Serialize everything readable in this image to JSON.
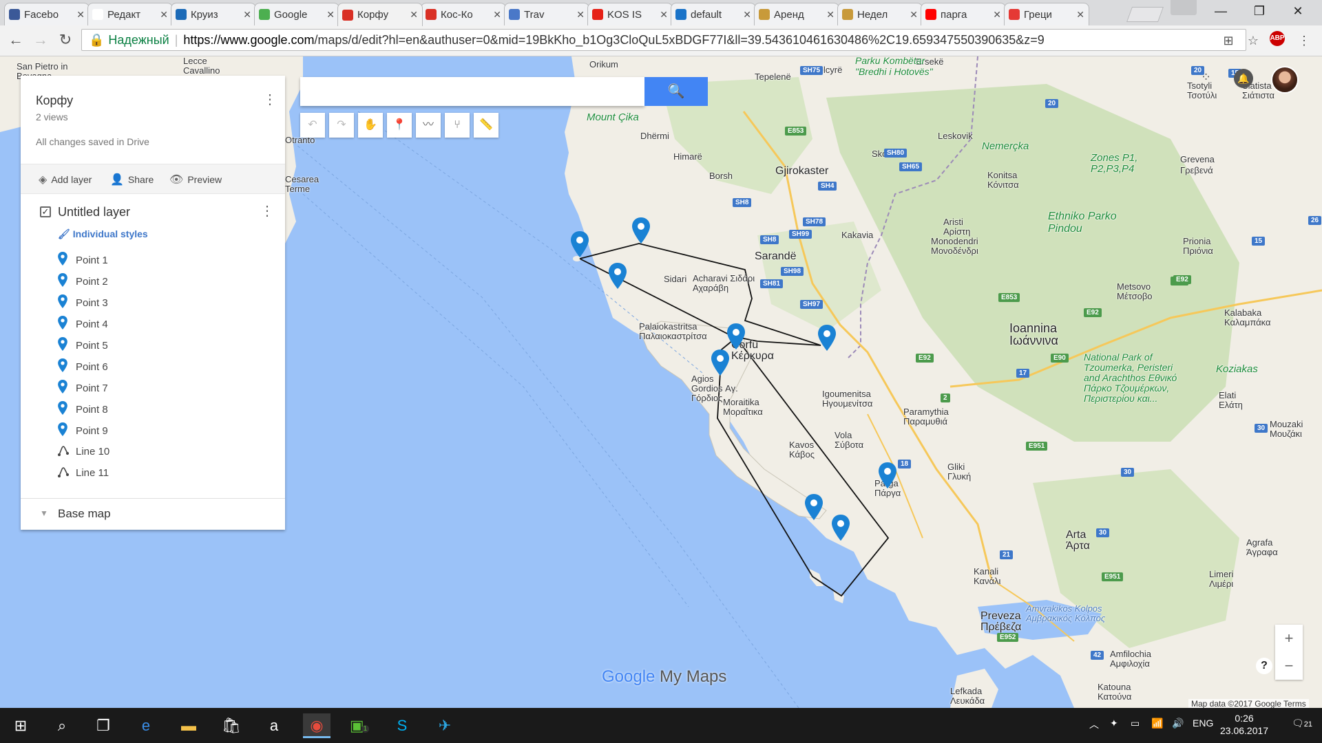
{
  "browser": {
    "tabs": [
      {
        "title": "Facebo",
        "color": "#3b5998"
      },
      {
        "title": "Редакт",
        "color": "#ffffff"
      },
      {
        "title": "Круиз",
        "color": "#1c6bb8"
      },
      {
        "title": "Google",
        "color": "#4caf50"
      },
      {
        "title": "Корфу",
        "color": "#d93025",
        "active": true
      },
      {
        "title": "Кос-Ко",
        "color": "#d93025"
      },
      {
        "title": "Trav",
        "color": "#4a78c8"
      },
      {
        "title": "KOS IS",
        "color": "#e62117"
      },
      {
        "title": "default",
        "color": "#1a73c8"
      },
      {
        "title": "Аренд",
        "color": "#c89a3a"
      },
      {
        "title": "Недел",
        "color": "#c89a3a"
      },
      {
        "title": "парга",
        "color": "#ff0000"
      },
      {
        "title": "Греци",
        "color": "#e53935"
      }
    ],
    "secure_label": "Надежный",
    "url_host": "https://www.google.com",
    "url_path": "/maps/d/edit?hl=en&authuser=0&mid=19BkKho_b1Og3CloQuL5xBDGF77I&ll=39.543610461630486%2C19.659347550390635&z=9",
    "abp_count": "1"
  },
  "panel": {
    "title": "Корфу",
    "views": "2 views",
    "saved": "All changes saved in Drive",
    "add_layer": "Add layer",
    "share": "Share",
    "preview": "Preview",
    "layer_name": "Untitled layer",
    "styles": "Individual styles",
    "items": [
      {
        "label": "Point 1",
        "kind": "point"
      },
      {
        "label": "Point 2",
        "kind": "point"
      },
      {
        "label": "Point 3",
        "kind": "point"
      },
      {
        "label": "Point 4",
        "kind": "point"
      },
      {
        "label": "Point 5",
        "kind": "point"
      },
      {
        "label": "Point 6",
        "kind": "point"
      },
      {
        "label": "Point 7",
        "kind": "point"
      },
      {
        "label": "Point 8",
        "kind": "point"
      },
      {
        "label": "Point 9",
        "kind": "point"
      },
      {
        "label": "Line 10",
        "kind": "line"
      },
      {
        "label": "Line 11",
        "kind": "line"
      }
    ],
    "base_map": "Base map"
  },
  "map": {
    "branding": {
      "google": "Google",
      "mymaps": " My Maps"
    },
    "attribution": "Map data ©2017 Google   Terms",
    "labels": [
      {
        "t": "Orikum"
      },
      {
        "t": "Tepelenë"
      },
      {
        "t": "Këlcyrë"
      },
      {
        "t": "Ersekë"
      },
      {
        "t": "Parku Kombëtar \"Bredhi i Hotovës\""
      },
      {
        "t": "Mount Çika"
      },
      {
        "t": "Dhërmi"
      },
      {
        "t": "Himarë"
      },
      {
        "t": "Borsh"
      },
      {
        "t": "Gjirokaster"
      },
      {
        "t": "Leskovik"
      },
      {
        "t": "Skore"
      },
      {
        "t": "Nemerçka"
      },
      {
        "t": "Zones P1, P2,P3,P4"
      },
      {
        "t": "Konitsa Κόνιτσα"
      },
      {
        "t": "Grevena Γρεβενά"
      },
      {
        "t": "Sarandë"
      },
      {
        "t": "Kakavia"
      },
      {
        "t": "Aristi Αρίστη"
      },
      {
        "t": "Monodendri Μονοδένδρι"
      },
      {
        "t": "Ethniko Parko Pindou"
      },
      {
        "t": "Prionia Πριόνια"
      },
      {
        "t": "Sidari"
      },
      {
        "t": "Acharavi Σιδάρι Αχαράβη"
      },
      {
        "t": "Metsovo Μέτσοβο"
      },
      {
        "t": "Kalabaka Καλαμπάκα"
      },
      {
        "t": "Palaiokastritsa Παλαιοκαστρίτσα"
      },
      {
        "t": "Corfu Κέρκυρα"
      },
      {
        "t": "Ioannina Ιωάννινα"
      },
      {
        "t": "Agios Gordios Αγ. Γόρδιος"
      },
      {
        "t": "Moraitika Μοραΐτικα"
      },
      {
        "t": "Igoumenitsa Ηγουμενίτσα"
      },
      {
        "t": "Paramythia Παραμυθιά"
      },
      {
        "t": "National Park of Tzoumerka, Peristeri and Arachthos Εθνικό Πάρκο Τζουμέρκων, Περιστερίου και..."
      },
      {
        "t": "Koziakas"
      },
      {
        "t": "Elati Ελάτη"
      },
      {
        "t": "Mouzaki Μουζάκι"
      },
      {
        "t": "Kavos Κάβος"
      },
      {
        "t": "Vola Σύβοτα"
      },
      {
        "t": "Parga Πάργα"
      },
      {
        "t": "Gliki Γλυκή"
      },
      {
        "t": "Arta Άρτα"
      },
      {
        "t": "Agrafa Άγραφα"
      },
      {
        "t": "Limeri Λιμέρι"
      },
      {
        "t": "Kanali Κανάλι"
      },
      {
        "t": "Preveza Πρέβεζα"
      },
      {
        "t": "Amvrakikos Kolpos Αμβρακικός Κόλπος"
      },
      {
        "t": "Amfilochia Αμφιλοχία"
      },
      {
        "t": "Lefkada Λευκάδα"
      },
      {
        "t": "Katouna Κατούνα"
      },
      {
        "t": "Tsotyli Τσοτύλι"
      },
      {
        "t": "Siatista Σιάτιστα"
      },
      {
        "t": "San Pietro in Bevagna"
      },
      {
        "t": "Lecce Cavallino"
      },
      {
        "t": "Otranto"
      },
      {
        "t": "Cesarea Terme"
      }
    ],
    "roads": [
      "SH75",
      "E853",
      "SH80",
      "SH65",
      "SH4",
      "SH8",
      "SH78",
      "SH99",
      "SH8",
      "SH98",
      "SH81",
      "SH97",
      "E853",
      "E92",
      "E92",
      "E92",
      "E90",
      "17",
      "E951",
      "2",
      "18",
      "30",
      "21",
      "E951",
      "E952",
      "42",
      "30",
      "15",
      "26",
      "20",
      "20",
      "E92",
      "15",
      "30"
    ]
  },
  "taskbar": {
    "lang": "ENG",
    "time": "0:26",
    "date": "23.06.2017",
    "notifications": "21",
    "badge": "1"
  },
  "colors": {
    "pin": "#1a82d4",
    "accent": "#4285f4",
    "land": "#f1eee6",
    "water": "#9bc2f8"
  }
}
